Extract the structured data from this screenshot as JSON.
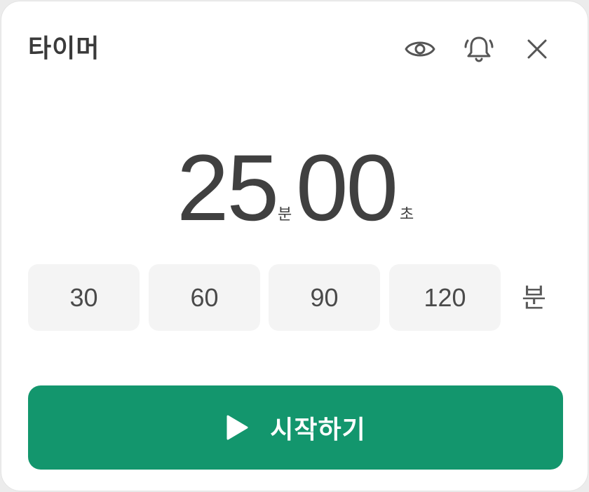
{
  "header": {
    "title": "타이머",
    "icons": [
      "eye-icon",
      "bell-icon",
      "close-icon"
    ]
  },
  "timer": {
    "minutes": "25",
    "minutes_unit": "분",
    "seconds": "00",
    "seconds_unit": "초"
  },
  "presets": {
    "options": [
      "30",
      "60",
      "90",
      "120"
    ],
    "unit": "분"
  },
  "start_button": {
    "label": "시작하기",
    "icon": "play-icon"
  },
  "colors": {
    "accent": "#13966d",
    "text": "#3d3d3d",
    "preset_bg": "#f4f4f4"
  }
}
